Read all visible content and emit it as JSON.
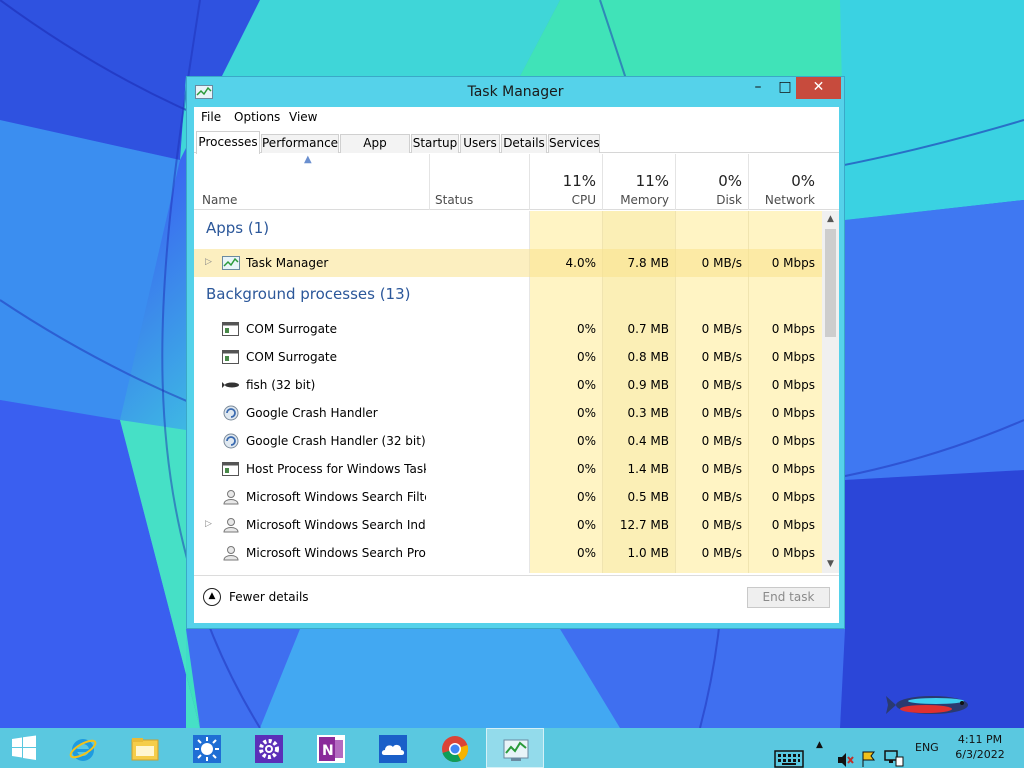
{
  "window": {
    "title": "Task Manager",
    "minimize": "–",
    "maximize": "□",
    "close": "✕"
  },
  "menu": [
    "File",
    "Options",
    "View"
  ],
  "tabs": [
    "Processes",
    "Performance",
    "App history",
    "Startup",
    "Users",
    "Details",
    "Services"
  ],
  "header": {
    "name": "Name",
    "status": "Status",
    "cpu": {
      "pct": "11%",
      "label": "CPU"
    },
    "memory": {
      "pct": "11%",
      "label": "Memory"
    },
    "disk": {
      "pct": "0%",
      "label": "Disk"
    },
    "network": {
      "pct": "0%",
      "label": "Network"
    }
  },
  "groups": {
    "apps": "Apps (1)",
    "background": "Background processes (13)"
  },
  "apps": [
    {
      "name": "Task Manager",
      "cpu": "4.0%",
      "memory": "7.8 MB",
      "disk": "0 MB/s",
      "network": "0 Mbps",
      "icon": "task-manager-icon",
      "expandable": true
    }
  ],
  "processes": [
    {
      "name": "COM Surrogate",
      "cpu": "0%",
      "memory": "0.7 MB",
      "disk": "0 MB/s",
      "network": "0 Mbps",
      "icon": "window-app-icon"
    },
    {
      "name": "COM Surrogate",
      "cpu": "0%",
      "memory": "0.8 MB",
      "disk": "0 MB/s",
      "network": "0 Mbps",
      "icon": "window-app-icon"
    },
    {
      "name": "fish (32 bit)",
      "cpu": "0%",
      "memory": "0.9 MB",
      "disk": "0 MB/s",
      "network": "0 Mbps",
      "icon": "fish-icon"
    },
    {
      "name": "Google Crash Handler",
      "cpu": "0%",
      "memory": "0.3 MB",
      "disk": "0 MB/s",
      "network": "0 Mbps",
      "icon": "google-updater-icon"
    },
    {
      "name": "Google Crash Handler (32 bit)",
      "cpu": "0%",
      "memory": "0.4 MB",
      "disk": "0 MB/s",
      "network": "0 Mbps",
      "icon": "google-updater-icon"
    },
    {
      "name": "Host Process for Windows Tasks",
      "cpu": "0%",
      "memory": "1.4 MB",
      "disk": "0 MB/s",
      "network": "0 Mbps",
      "icon": "window-app-icon"
    },
    {
      "name": "Microsoft Windows Search Filte...",
      "cpu": "0%",
      "memory": "0.5 MB",
      "disk": "0 MB/s",
      "network": "0 Mbps",
      "icon": "search-user-icon"
    },
    {
      "name": "Microsoft Windows Search Inde...",
      "cpu": "0%",
      "memory": "12.7 MB",
      "disk": "0 MB/s",
      "network": "0 Mbps",
      "icon": "search-user-icon",
      "expandable": true
    },
    {
      "name": "Microsoft Windows Search Prot...",
      "cpu": "0%",
      "memory": "1.0 MB",
      "disk": "0 MB/s",
      "network": "0 Mbps",
      "icon": "search-user-icon"
    }
  ],
  "footer": {
    "fewer_details": "Fewer details",
    "end_task": "End task"
  },
  "taskbar": {
    "items": [
      "start-icon",
      "internet-explorer-icon",
      "file-explorer-icon",
      "weather-icon",
      "settings-icon",
      "onenote-icon",
      "onedrive-icon",
      "chrome-icon",
      "task-manager-icon"
    ],
    "language": "ENG",
    "time": "4:11 PM",
    "date": "6/3/2022"
  },
  "colors": {
    "accent": "#2b579a",
    "window_frame": "#55d2ea",
    "heat_light": "#fff4c4",
    "heat_strong": "#f9eca8",
    "close": "#c74b3d"
  }
}
